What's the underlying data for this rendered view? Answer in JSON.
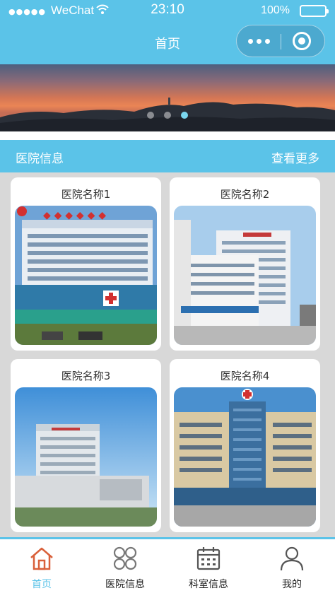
{
  "status_bar": {
    "signal": "●●●●●",
    "carrier": "WeChat",
    "time": "23:10",
    "battery": "100%",
    "battery_level": 1.0
  },
  "nav": {
    "title": "首页"
  },
  "carousel": {
    "slide_count": 3,
    "active_index": 2
  },
  "section": {
    "title": "医院信息",
    "more_label": "查看更多"
  },
  "hospitals": [
    {
      "name": "医院名称1"
    },
    {
      "name": "医院名称2"
    },
    {
      "name": "医院名称3"
    },
    {
      "name": "医院名称4"
    }
  ],
  "tabs": [
    {
      "label": "首页",
      "icon": "home-icon",
      "active": true
    },
    {
      "label": "医院信息",
      "icon": "grid-icon",
      "active": false
    },
    {
      "label": "科室信息",
      "icon": "calendar-icon",
      "active": false
    },
    {
      "label": "我的",
      "icon": "user-icon",
      "active": false
    }
  ],
  "colors": {
    "primary": "#5bc3e8",
    "active_tab_icon": "#d9603a",
    "grid_background": "#d8d8d8"
  }
}
